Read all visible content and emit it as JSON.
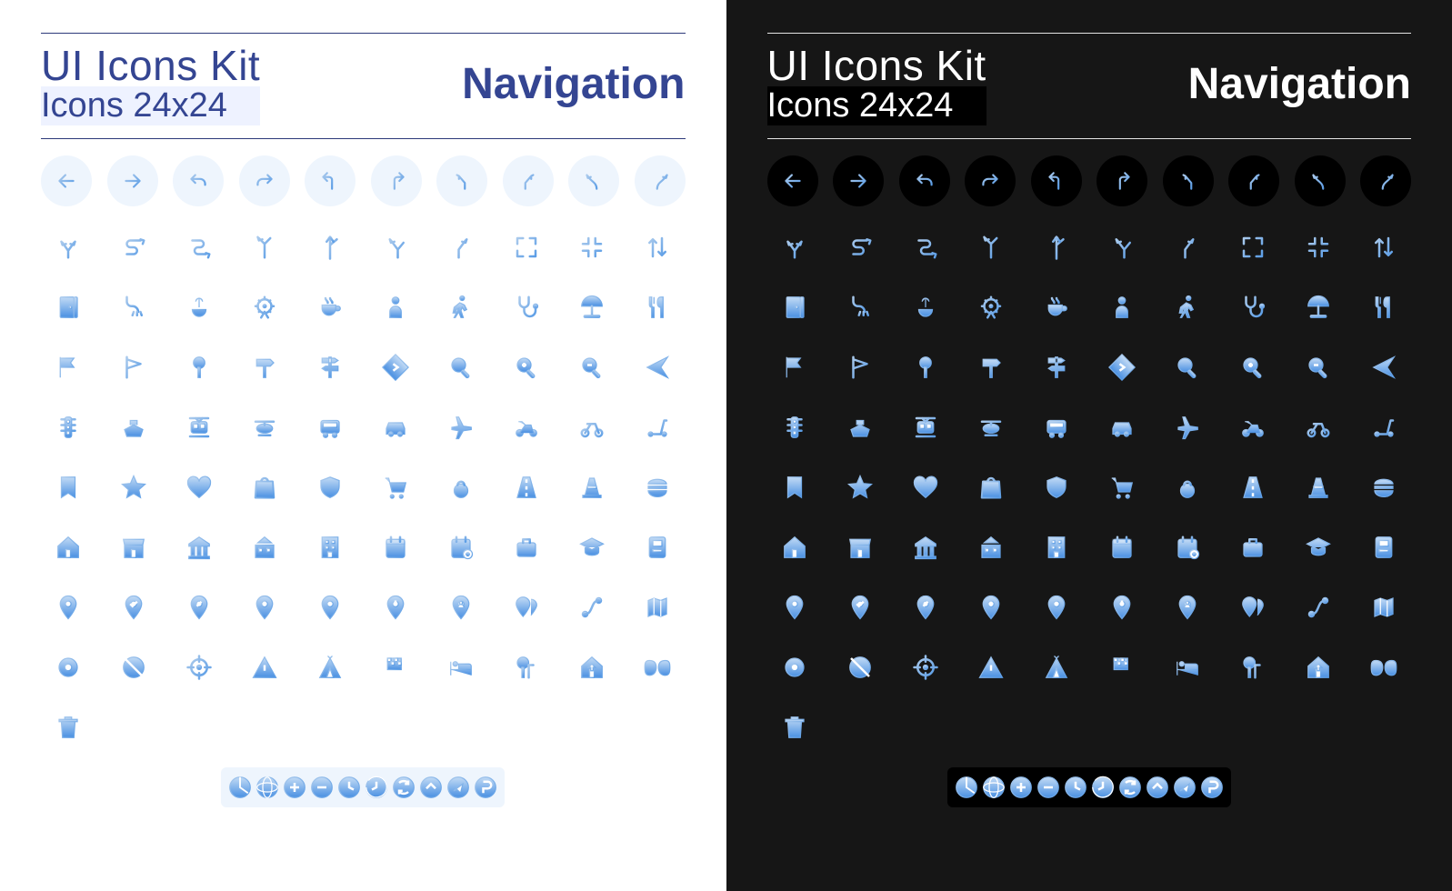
{
  "colors": {
    "light_bg": "#ffffff",
    "dark_bg": "#161616",
    "light_circ": "#eef5fd",
    "dark_circ": "#000000",
    "grad_top": "#bcd6f3",
    "grad_bot": "#4a90e2",
    "accent_navy": "#344592"
  },
  "header": {
    "title": "UI Icons Kit",
    "subtitle": "Icons 24x24",
    "category": "Navigation"
  },
  "circled_arrows": [
    "arrow-left",
    "arrow-right",
    "undo",
    "redo",
    "turn-left",
    "turn-right",
    "bear-left",
    "bear-right",
    "curve-left",
    "curve-right"
  ],
  "icon_rows": [
    [
      "split-road",
      "winding-road",
      "s-curve",
      "fork-left",
      "fork-straight",
      "slight-left",
      "slight-right",
      "expand",
      "collapse",
      "swap-vertical"
    ],
    [
      "door",
      "shower",
      "fountain",
      "ferris-wheel",
      "coffee",
      "person",
      "walking",
      "stethoscope",
      "umbrella",
      "restaurant"
    ],
    [
      "flag-solid",
      "flag-outline",
      "pin-round",
      "signpost-right",
      "signpost-multi",
      "diamond-sign",
      "search",
      "zoom-in",
      "zoom-out",
      "send"
    ],
    [
      "traffic-light",
      "ship",
      "tram",
      "helicopter",
      "bus",
      "car",
      "plane",
      "motorcycle",
      "bicycle",
      "scooter"
    ],
    [
      "bookmark",
      "star",
      "heart",
      "shopping-bag",
      "shield",
      "cart",
      "kettlebell",
      "road",
      "cone",
      "burger"
    ],
    [
      "home",
      "store",
      "bank",
      "school",
      "office",
      "calendar",
      "calendar-add",
      "briefcase",
      "graduation",
      "atm"
    ],
    [
      "pin",
      "pin-check",
      "pin-edit",
      "pin-add",
      "pin-remove",
      "pin-alert",
      "pin-user",
      "pin-group",
      "route",
      "map"
    ],
    [
      "target",
      "compass-off",
      "crosshair",
      "warning",
      "camping",
      "flag-checkered",
      "bed",
      "park",
      "home-arrow",
      "masks",
      "trash"
    ],
    [
      "pie",
      "globe",
      "plus-circle",
      "minus-circle",
      "clock",
      "history",
      "refresh",
      "up-circle",
      "navigate-circle",
      "parking"
    ]
  ]
}
